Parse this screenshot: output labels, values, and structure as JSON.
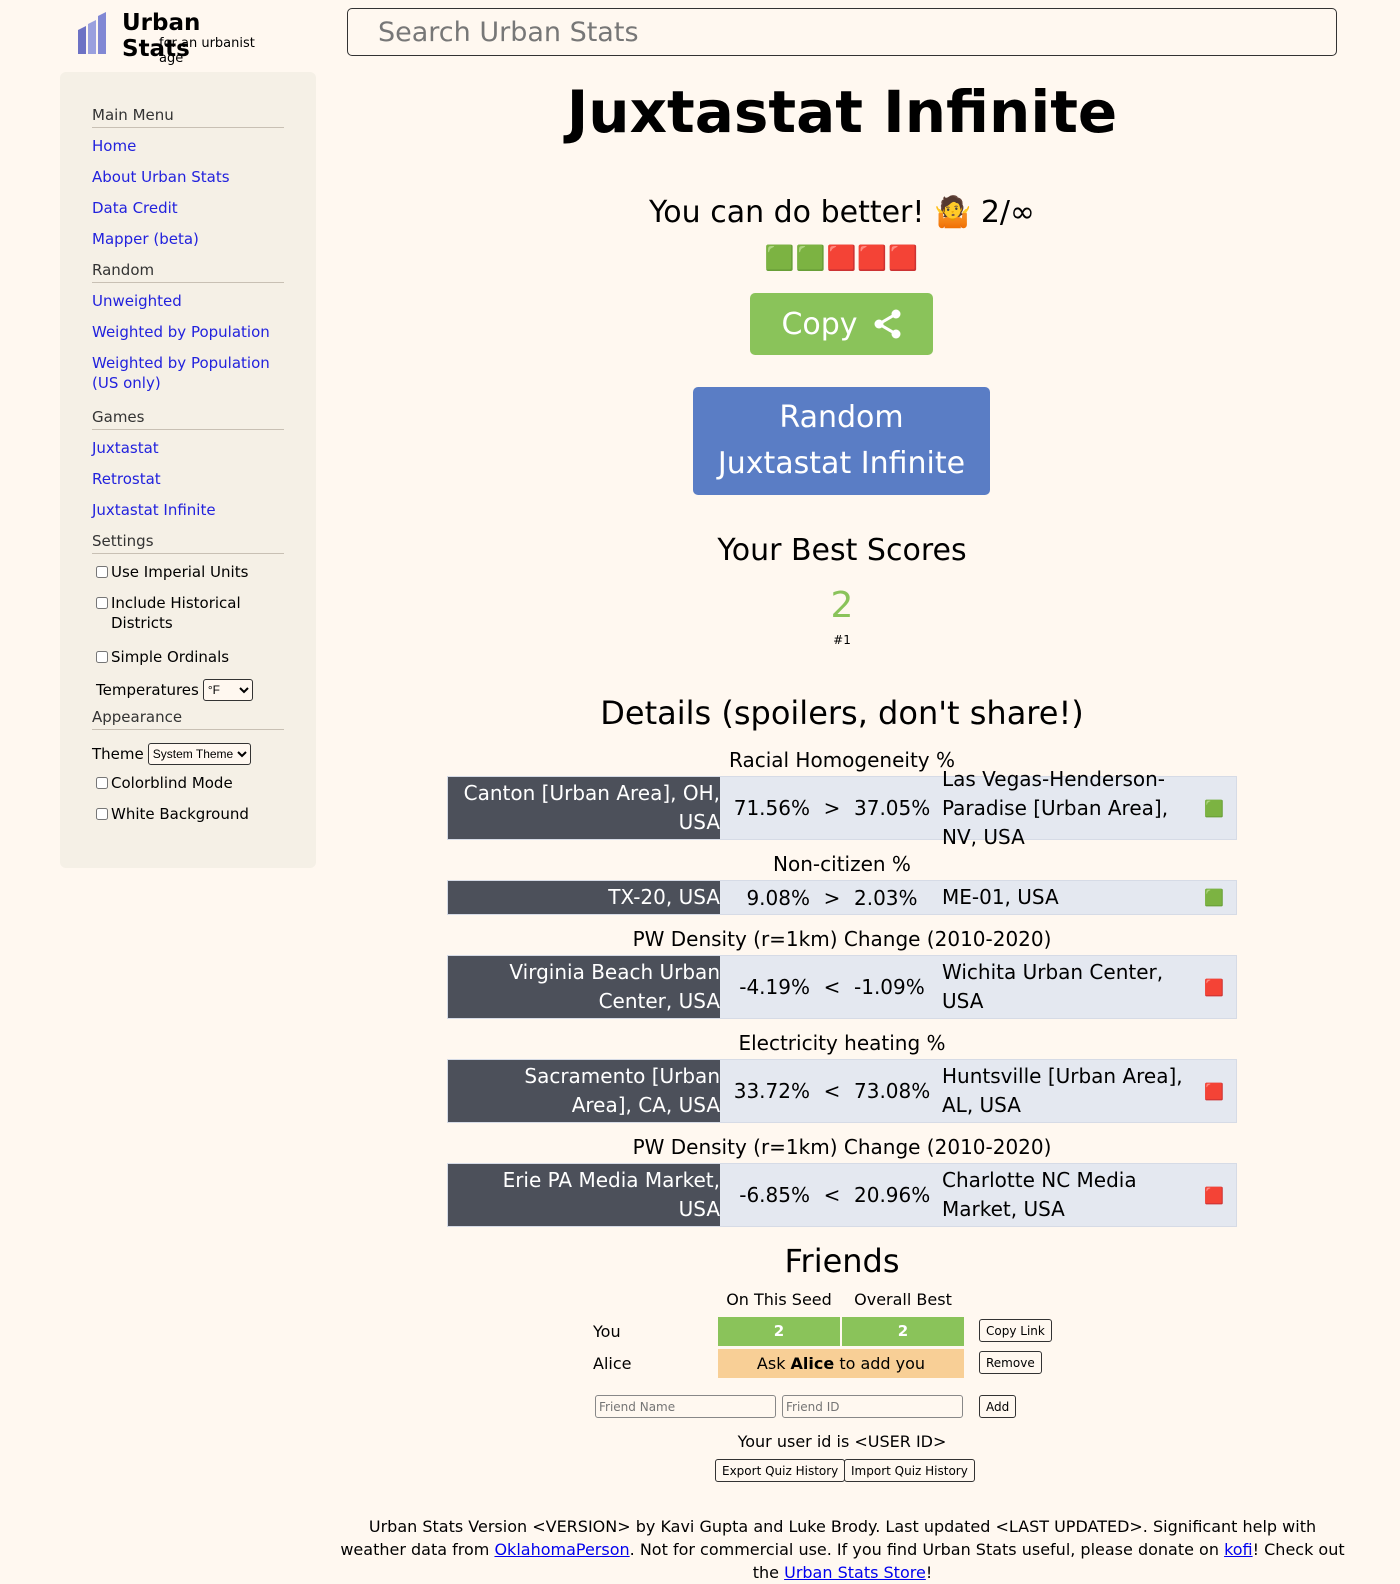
{
  "header": {
    "logo_title": "Urban Stats",
    "logo_subtitle": "for an urbanist age",
    "search_placeholder": "Search Urban Stats"
  },
  "sidebar": {
    "main_menu": {
      "heading": "Main Menu",
      "items": [
        "Home",
        "About Urban Stats",
        "Data Credit",
        "Mapper (beta)"
      ]
    },
    "random": {
      "heading": "Random",
      "items": [
        "Unweighted",
        "Weighted by Population",
        "Weighted by Population (US only)"
      ]
    },
    "games": {
      "heading": "Games",
      "items": [
        "Juxtastat",
        "Retrostat",
        "Juxtastat Infinite"
      ]
    },
    "settings": {
      "heading": "Settings",
      "imperial": "Use Imperial Units",
      "historical": "Include Historical Districts",
      "ordinals": "Simple Ordinals",
      "temperatures_label": "Temperatures",
      "temperatures_value": "°F"
    },
    "appearance": {
      "heading": "Appearance",
      "theme_label": "Theme",
      "theme_value": "System Theme",
      "colorblind": "Colorblind Mode",
      "white_bg": "White Background"
    }
  },
  "quiz": {
    "title": "Juxtastat Infinite",
    "result_text": "You can do better! 🤷 2/∞",
    "result_emojis": "🟩🟩🟥🟥🟥",
    "copy_label": "Copy",
    "random_button": "Random Juxtastat Infinite",
    "best_heading": "Your Best Scores",
    "best_score": "2",
    "best_rank": "#1",
    "details_heading": "Details (spoilers, don't share!)",
    "questions": [
      {
        "stat": "Racial Homogeneity %",
        "left": "Canton [Urban Area], OH, USA",
        "left_value": "71.56%",
        "op": ">",
        "right_value": "37.05%",
        "right": "Las Vegas-Henderson-Paradise [Urban Area], NV, USA",
        "mark": "🟩"
      },
      {
        "stat": "Non-citizen %",
        "left": "TX-20, USA",
        "left_value": "9.08%",
        "op": ">",
        "right_value": "2.03%",
        "right": "ME-01, USA",
        "mark": "🟩"
      },
      {
        "stat": "PW Density (r=1km) Change (2010-2020)",
        "left": "Virginia Beach Urban Center, USA",
        "left_value": "-4.19%",
        "op": "<",
        "right_value": "-1.09%",
        "right": "Wichita Urban Center, USA",
        "mark": "🟥"
      },
      {
        "stat": "Electricity heating %",
        "left": "Sacramento [Urban Area], CA, USA",
        "left_value": "33.72%",
        "op": "<",
        "right_value": "73.08%",
        "right": "Huntsville [Urban Area], AL, USA",
        "mark": "🟥"
      },
      {
        "stat": "PW Density (r=1km) Change (2010-2020)",
        "left": "Erie PA Media Market, USA",
        "left_value": "-6.85%",
        "op": "<",
        "right_value": "20.96%",
        "right": "Charlotte NC Media Market, USA",
        "mark": "🟥"
      }
    ]
  },
  "friends": {
    "heading": "Friends",
    "col_seed": "On This Seed",
    "col_best": "Overall Best",
    "you_label": "You",
    "you_seed": "2",
    "you_best": "2",
    "copy_link": "Copy Link",
    "friend_name": "Alice",
    "ask_prefix": "Ask ",
    "ask_suffix": " to add you",
    "remove": "Remove",
    "name_placeholder": "Friend Name",
    "id_placeholder": "Friend ID",
    "add": "Add",
    "user_id_text": "Your user id is <USER ID>",
    "export": "Export Quiz History",
    "import": "Import Quiz History"
  },
  "footer": {
    "text1": "Urban Stats Version <VERSION> by Kavi Gupta and Luke Brody. Last updated <LAST UPDATED>. Significant help with weather data from ",
    "link1": "OklahomaPerson",
    "text2": ". Not for commercial use. If you find Urban Stats useful, please donate on ",
    "link2": "kofi",
    "text3": "! Check out the ",
    "link3": "Urban Stats Store",
    "text4": "!"
  },
  "colors": {
    "background": "#fff8f0",
    "correct": "#8ac35a",
    "random_button": "#5a7dc5",
    "pending": "#f8cf96",
    "winner_cell": "#4c505a",
    "row_bg": "#e4e8f0"
  }
}
